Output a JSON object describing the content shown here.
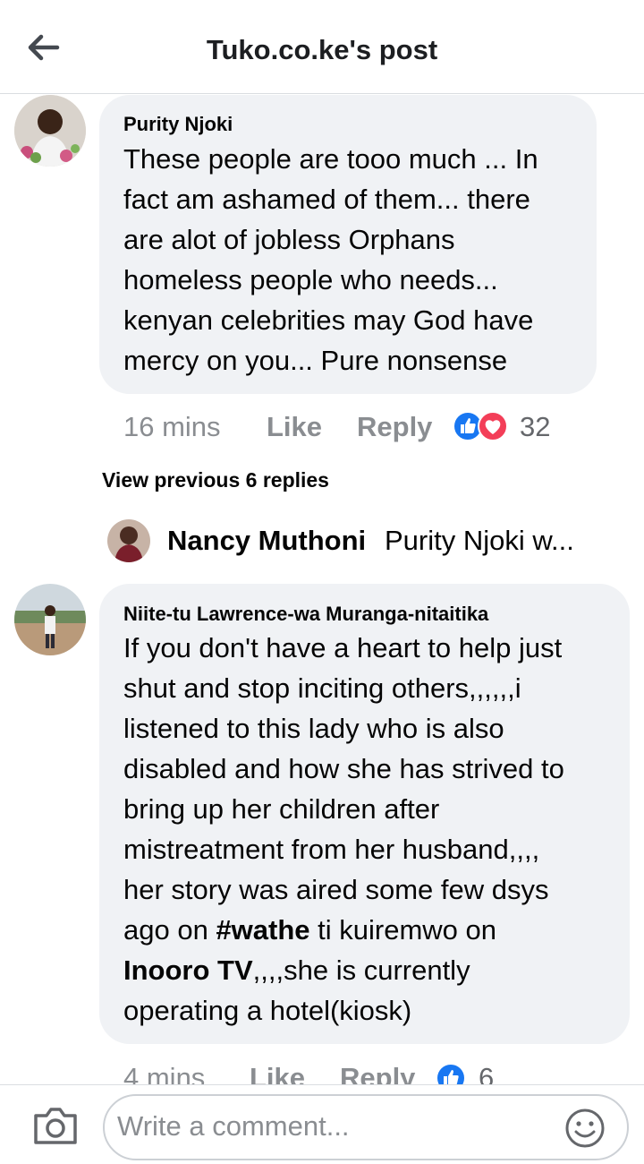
{
  "header": {
    "title": "Tuko.co.ke's post",
    "back_icon": "arrow-left-icon"
  },
  "comments": [
    {
      "author": "Purity Njoki",
      "lines": [
        "These people are tooo much ... In",
        "fact am ashamed of them... there",
        "are alot of jobless Orphans",
        "homeless people who needs...",
        "kenyan celebrities may God have",
        "mercy on you... Pure nonsense"
      ],
      "time": "16 mins",
      "like_label": "Like",
      "reply_label": "Reply",
      "reaction_count": "32",
      "reactions": [
        "like-reaction-icon",
        "love-reaction-icon"
      ]
    },
    {
      "author": "Niite-tu Lawrence-wa Muranga-nitaitika",
      "lines": [
        "If you don't have a heart to help just",
        "shut and stop inciting others,,,,,,i",
        "listened to this lady who is also",
        "disabled and how she has strived to",
        "bring up her children after",
        "mistreatment from her husband,,,,",
        "her story was aired some few dsys",
        "ago on #wathe ti kuiremwo on",
        "Inooro TV,,,,she is currently",
        "operating a hotel(kiosk)"
      ],
      "bold_words": [
        "#wathe",
        "Inooro TV"
      ],
      "time": "4 mins",
      "like_label": "Like",
      "reply_label": "Reply",
      "reaction_count": "6",
      "reactions": [
        "like-reaction-icon"
      ]
    }
  ],
  "replies": {
    "view_previous": "View previous 6 replies",
    "latest_author": "Nancy Muthoni",
    "latest_preview": "Purity Njoki w..."
  },
  "composer": {
    "placeholder": "Write a comment...",
    "camera_icon": "camera-icon",
    "emoji_icon": "emoji-icon"
  },
  "colors": {
    "bubble": "#f0f2f5",
    "meta_text": "#8a8d91",
    "like_blue": "#1877f2",
    "love_red": "#f33e58"
  }
}
